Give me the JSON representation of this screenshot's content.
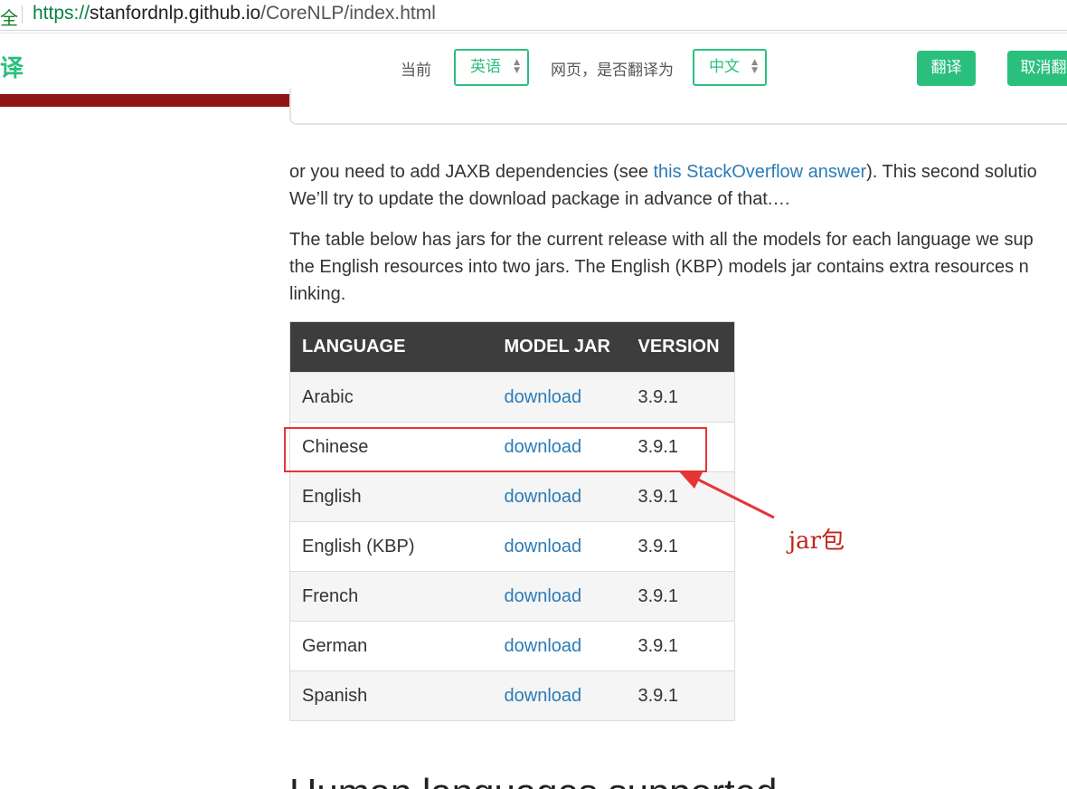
{
  "browser": {
    "lock_glyph": "全",
    "url_scheme": "https://",
    "url_host": "stanfordnlp.github.io",
    "url_path": "/CoreNLP/index.html"
  },
  "translate_bar": {
    "logo_glyph": "译",
    "current_label": "当前",
    "source_language": "英语",
    "prompt_label": "网页，是否翻译为",
    "target_language": "中文",
    "translate_button": "翻译",
    "cancel_button": "取消翻",
    "accent_color": "#2bbf7e"
  },
  "content": {
    "para1_line1_pre": "or you need to add JAXB dependencies (see ",
    "para1_link": "this StackOverflow answer",
    "para1_line1_post": "). This second solutio",
    "para1_line2": "We’ll try to update the download package in advance of that.…",
    "para2_line1": "The table below has jars for the current release with all the models for each language we sup",
    "para2_line2": "the English resources into two jars. The English (KBP) models jar contains extra resources n",
    "para2_line3": "linking.",
    "table": {
      "headers": [
        "LANGUAGE",
        "MODEL JAR",
        "VERSION"
      ],
      "rows": [
        {
          "language": "Arabic",
          "jar": "download",
          "version": "3.9.1"
        },
        {
          "language": "Chinese",
          "jar": "download",
          "version": "3.9.1"
        },
        {
          "language": "English",
          "jar": "download",
          "version": "3.9.1"
        },
        {
          "language": "English (KBP)",
          "jar": "download",
          "version": "3.9.1"
        },
        {
          "language": "French",
          "jar": "download",
          "version": "3.9.1"
        },
        {
          "language": "German",
          "jar": "download",
          "version": "3.9.1"
        },
        {
          "language": "Spanish",
          "jar": "download",
          "version": "3.9.1"
        }
      ]
    },
    "next_heading": "Human languages supported"
  },
  "annotation": {
    "label": "jar包",
    "color": "#e53535"
  }
}
